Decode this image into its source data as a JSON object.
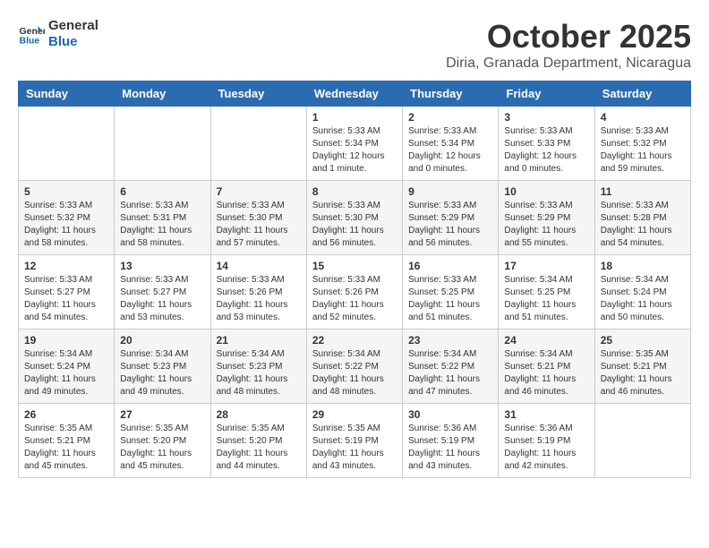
{
  "header": {
    "logo_line1": "General",
    "logo_line2": "Blue",
    "month": "October 2025",
    "location": "Diria, Granada Department, Nicaragua"
  },
  "weekdays": [
    "Sunday",
    "Monday",
    "Tuesday",
    "Wednesday",
    "Thursday",
    "Friday",
    "Saturday"
  ],
  "weeks": [
    [
      {
        "day": "",
        "info": ""
      },
      {
        "day": "",
        "info": ""
      },
      {
        "day": "",
        "info": ""
      },
      {
        "day": "1",
        "info": "Sunrise: 5:33 AM\nSunset: 5:34 PM\nDaylight: 12 hours\nand 1 minute."
      },
      {
        "day": "2",
        "info": "Sunrise: 5:33 AM\nSunset: 5:34 PM\nDaylight: 12 hours\nand 0 minutes."
      },
      {
        "day": "3",
        "info": "Sunrise: 5:33 AM\nSunset: 5:33 PM\nDaylight: 12 hours\nand 0 minutes."
      },
      {
        "day": "4",
        "info": "Sunrise: 5:33 AM\nSunset: 5:32 PM\nDaylight: 11 hours\nand 59 minutes."
      }
    ],
    [
      {
        "day": "5",
        "info": "Sunrise: 5:33 AM\nSunset: 5:32 PM\nDaylight: 11 hours\nand 58 minutes."
      },
      {
        "day": "6",
        "info": "Sunrise: 5:33 AM\nSunset: 5:31 PM\nDaylight: 11 hours\nand 58 minutes."
      },
      {
        "day": "7",
        "info": "Sunrise: 5:33 AM\nSunset: 5:30 PM\nDaylight: 11 hours\nand 57 minutes."
      },
      {
        "day": "8",
        "info": "Sunrise: 5:33 AM\nSunset: 5:30 PM\nDaylight: 11 hours\nand 56 minutes."
      },
      {
        "day": "9",
        "info": "Sunrise: 5:33 AM\nSunset: 5:29 PM\nDaylight: 11 hours\nand 56 minutes."
      },
      {
        "day": "10",
        "info": "Sunrise: 5:33 AM\nSunset: 5:29 PM\nDaylight: 11 hours\nand 55 minutes."
      },
      {
        "day": "11",
        "info": "Sunrise: 5:33 AM\nSunset: 5:28 PM\nDaylight: 11 hours\nand 54 minutes."
      }
    ],
    [
      {
        "day": "12",
        "info": "Sunrise: 5:33 AM\nSunset: 5:27 PM\nDaylight: 11 hours\nand 54 minutes."
      },
      {
        "day": "13",
        "info": "Sunrise: 5:33 AM\nSunset: 5:27 PM\nDaylight: 11 hours\nand 53 minutes."
      },
      {
        "day": "14",
        "info": "Sunrise: 5:33 AM\nSunset: 5:26 PM\nDaylight: 11 hours\nand 53 minutes."
      },
      {
        "day": "15",
        "info": "Sunrise: 5:33 AM\nSunset: 5:26 PM\nDaylight: 11 hours\nand 52 minutes."
      },
      {
        "day": "16",
        "info": "Sunrise: 5:33 AM\nSunset: 5:25 PM\nDaylight: 11 hours\nand 51 minutes."
      },
      {
        "day": "17",
        "info": "Sunrise: 5:34 AM\nSunset: 5:25 PM\nDaylight: 11 hours\nand 51 minutes."
      },
      {
        "day": "18",
        "info": "Sunrise: 5:34 AM\nSunset: 5:24 PM\nDaylight: 11 hours\nand 50 minutes."
      }
    ],
    [
      {
        "day": "19",
        "info": "Sunrise: 5:34 AM\nSunset: 5:24 PM\nDaylight: 11 hours\nand 49 minutes."
      },
      {
        "day": "20",
        "info": "Sunrise: 5:34 AM\nSunset: 5:23 PM\nDaylight: 11 hours\nand 49 minutes."
      },
      {
        "day": "21",
        "info": "Sunrise: 5:34 AM\nSunset: 5:23 PM\nDaylight: 11 hours\nand 48 minutes."
      },
      {
        "day": "22",
        "info": "Sunrise: 5:34 AM\nSunset: 5:22 PM\nDaylight: 11 hours\nand 48 minutes."
      },
      {
        "day": "23",
        "info": "Sunrise: 5:34 AM\nSunset: 5:22 PM\nDaylight: 11 hours\nand 47 minutes."
      },
      {
        "day": "24",
        "info": "Sunrise: 5:34 AM\nSunset: 5:21 PM\nDaylight: 11 hours\nand 46 minutes."
      },
      {
        "day": "25",
        "info": "Sunrise: 5:35 AM\nSunset: 5:21 PM\nDaylight: 11 hours\nand 46 minutes."
      }
    ],
    [
      {
        "day": "26",
        "info": "Sunrise: 5:35 AM\nSunset: 5:21 PM\nDaylight: 11 hours\nand 45 minutes."
      },
      {
        "day": "27",
        "info": "Sunrise: 5:35 AM\nSunset: 5:20 PM\nDaylight: 11 hours\nand 45 minutes."
      },
      {
        "day": "28",
        "info": "Sunrise: 5:35 AM\nSunset: 5:20 PM\nDaylight: 11 hours\nand 44 minutes."
      },
      {
        "day": "29",
        "info": "Sunrise: 5:35 AM\nSunset: 5:19 PM\nDaylight: 11 hours\nand 43 minutes."
      },
      {
        "day": "30",
        "info": "Sunrise: 5:36 AM\nSunset: 5:19 PM\nDaylight: 11 hours\nand 43 minutes."
      },
      {
        "day": "31",
        "info": "Sunrise: 5:36 AM\nSunset: 5:19 PM\nDaylight: 11 hours\nand 42 minutes."
      },
      {
        "day": "",
        "info": ""
      }
    ]
  ]
}
